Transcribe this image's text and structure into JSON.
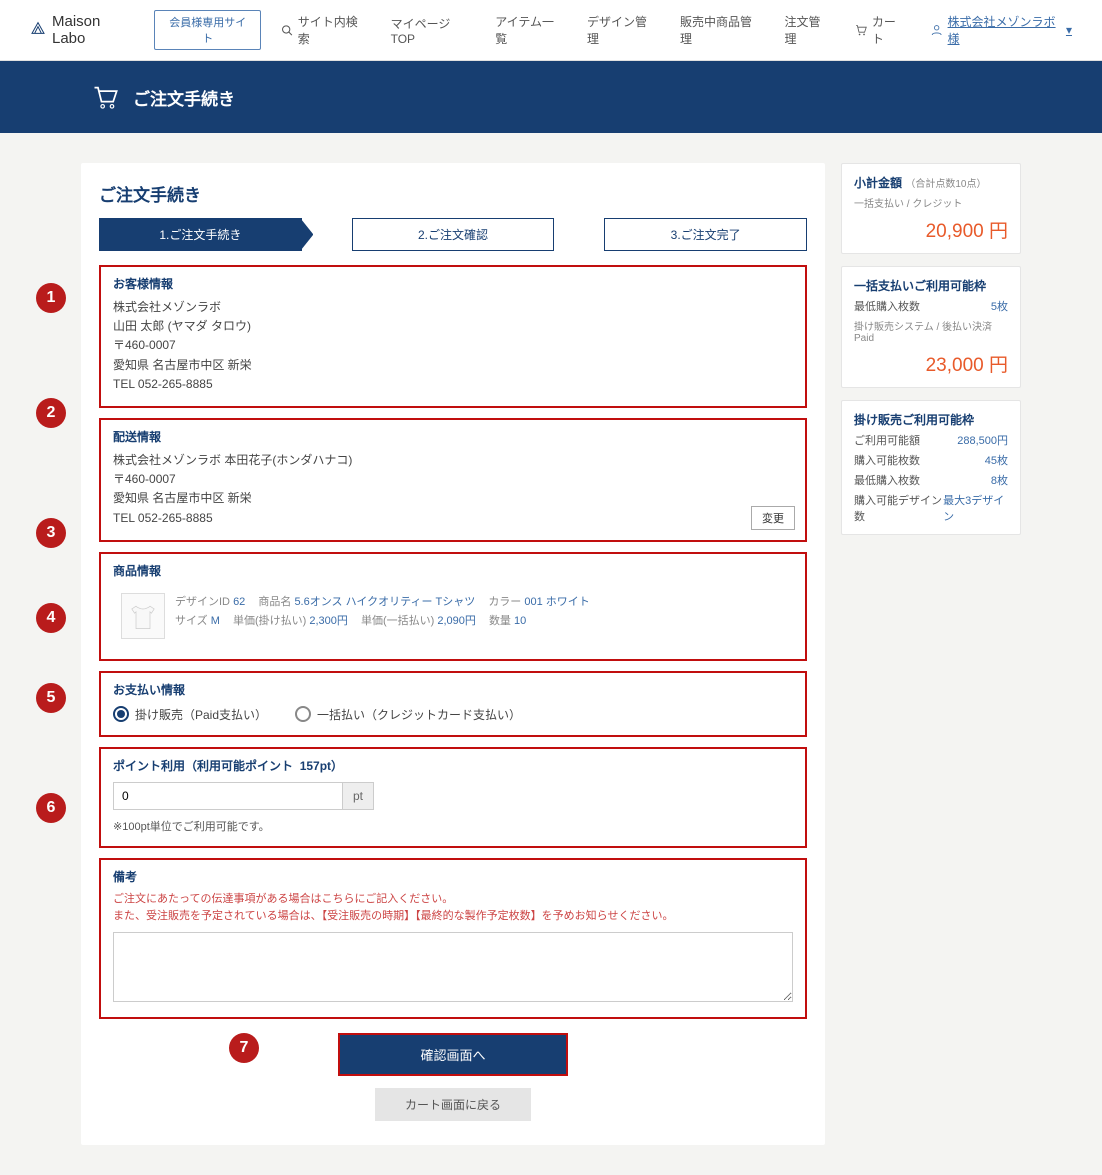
{
  "header": {
    "logo_text": "Maison Labo",
    "member_btn": "会員様専用サイト",
    "nav": {
      "search": "サイト内検索",
      "mypage": "マイページTOP",
      "items": "アイテム一覧",
      "design": "デザイン管理",
      "selling": "販売中商品管理",
      "orders": "注文管理",
      "cart": "カート",
      "user": "株式会社メゾンラボ様"
    }
  },
  "titlebar": "ご注文手続き",
  "page_title": "ご注文手続き",
  "steps": [
    "1.ご注文手続き",
    "2.ご注文確認",
    "3.ご注文完了"
  ],
  "customer": {
    "heading": "お客様情報",
    "company": "株式会社メゾンラボ",
    "name": "山田 太郎 (ヤマダ タロウ)",
    "zip": "〒460-0007",
    "address": "愛知県 名古屋市中区 新栄",
    "tel": "TEL 052-265-8885"
  },
  "shipping": {
    "heading": "配送情報",
    "line1": "株式会社メゾンラボ 本田花子(ホンダハナコ)",
    "zip": "〒460-0007",
    "address": "愛知県 名古屋市中区 新栄",
    "tel": "TEL 052-265-8885",
    "change_btn": "変更"
  },
  "product": {
    "heading": "商品情報",
    "labels": {
      "design_id": "デザインID",
      "name": "商品名",
      "color": "カラー",
      "size": "サイズ",
      "unit_kake": "単価(掛け払い)",
      "unit_ikkatsu": "単価(一括払い)",
      "qty": "数量"
    },
    "design_id": "62",
    "name": "5.6オンス ハイクオリティー Tシャツ",
    "color": "001 ホワイト",
    "size": "M",
    "unit_kake": "2,300円",
    "unit_ikkatsu": "2,090円",
    "qty": "10"
  },
  "payment": {
    "heading": "お支払い情報",
    "option1": "掛け販売（Paid支払い）",
    "option2": "一括払い（クレジットカード支払い）"
  },
  "points": {
    "heading_prefix": "ポイント利用（利用可能ポイント",
    "available": "157pt",
    "heading_suffix": "）",
    "input_value": "0",
    "unit": "pt",
    "note": "※100pt単位でご利用可能です。"
  },
  "remarks": {
    "heading": "備考",
    "note1": "ご注文にあたっての伝達事項がある場合はこちらにご記入ください。",
    "note2": "また、受注販売を予定されている場合は、【受注販売の時期】【最終的な製作予定枚数】を予めお知らせください。"
  },
  "buttons": {
    "confirm": "確認画面へ",
    "back": "カート画面に戻る"
  },
  "sidebar": {
    "subtotal": {
      "title": "小計金額",
      "sub": "（合計点数10点）",
      "method": "一括支払い / クレジット",
      "amount": "20,900 円"
    },
    "ikkatsu": {
      "title": "一括支払いご利用可能枠",
      "min_label": "最低購入枚数",
      "min_val": "5枚",
      "meta": "掛け販売システム / 後払い決済Paid",
      "amount": "23,000 円"
    },
    "kake": {
      "title": "掛け販売ご利用可能枠",
      "rows": [
        {
          "l": "ご利用可能額",
          "r": "288,500円"
        },
        {
          "l": "購入可能枚数",
          "r": "45枚"
        },
        {
          "l": "最低購入枚数",
          "r": "8枚"
        },
        {
          "l": "購入可能デザイン数",
          "r": "最大3デザイン"
        }
      ]
    }
  },
  "badges": [
    "1",
    "2",
    "3",
    "4",
    "5",
    "6",
    "7"
  ]
}
